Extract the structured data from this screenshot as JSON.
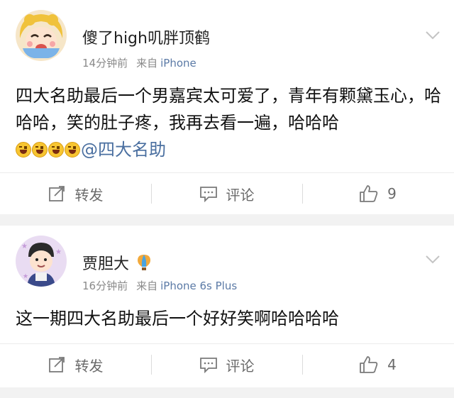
{
  "posts": [
    {
      "username": "傻了high叽胖顶鹤",
      "time": "14分钟前",
      "source_label": "来自",
      "source": "iPhone",
      "text_part1": "四大名助最后一个男嘉宾太可爱了，青年有颗黛玉心，哈哈哈，笑的肚子疼，我再去看一遍，哈哈哈",
      "emoji_count": 4,
      "mention": "@四大名助",
      "actions": {
        "repost": "转发",
        "comment": "评论",
        "likes": "9"
      }
    },
    {
      "username": "贾胆大",
      "time": "16分钟前",
      "source_label": "来自",
      "source": "iPhone 6s Plus",
      "text_part1": "这一期四大名助最后一个好好笑啊哈哈哈哈",
      "actions": {
        "repost": "转发",
        "comment": "评论",
        "likes": "4"
      }
    }
  ],
  "icons": {
    "chevron": "chevron-down-icon",
    "repost": "repost-icon",
    "comment": "comment-icon",
    "like": "thumbs-up-icon",
    "badge": "hot-air-balloon-icon",
    "emoji": "laughing-emoji-icon"
  }
}
